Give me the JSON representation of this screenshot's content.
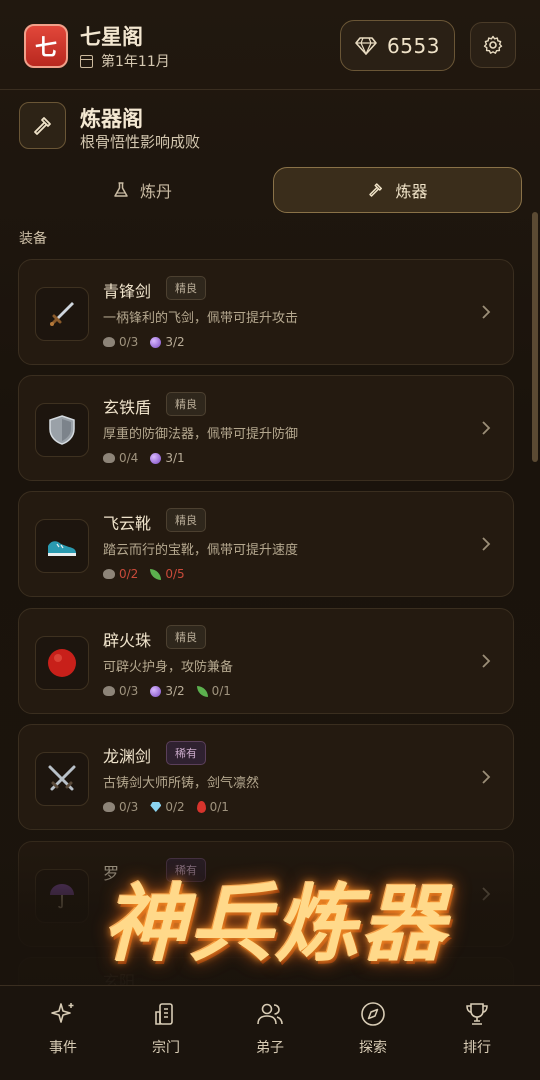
{
  "header": {
    "sect_badge": "七",
    "sect_name": "七星阁",
    "date": "第1年11月",
    "gems": "6553"
  },
  "section": {
    "title": "炼器阁",
    "subtitle": "根骨悟性影响成败"
  },
  "tabs": [
    {
      "label": "炼丹",
      "active": false
    },
    {
      "label": "炼器",
      "active": true
    }
  ],
  "group_label": "装备",
  "items": [
    {
      "name": "青锋剑",
      "tag": "精良",
      "rare": false,
      "desc": "一柄锋利的飞剑，佩带可提升攻击",
      "icon": "sword-icon",
      "mats": [
        {
          "icon": "ore-icon",
          "text": "0/3"
        },
        {
          "icon": "orb-icon",
          "text": "3/2"
        }
      ]
    },
    {
      "name": "玄铁盾",
      "tag": "精良",
      "rare": false,
      "desc": "厚重的防御法器，佩带可提升防御",
      "icon": "shield-icon",
      "mats": [
        {
          "icon": "ore-icon",
          "text": "0/4"
        },
        {
          "icon": "orb-icon",
          "text": "3/1"
        }
      ]
    },
    {
      "name": "飞云靴",
      "tag": "精良",
      "rare": false,
      "desc": "踏云而行的宝靴，佩带可提升速度",
      "icon": "boot-icon",
      "mats": [
        {
          "icon": "ore-icon",
          "text": "0/2"
        },
        {
          "icon": "leaf-icon",
          "text": "0/5"
        }
      ]
    },
    {
      "name": "辟火珠",
      "tag": "精良",
      "rare": false,
      "desc": "可辟火护身，攻防兼备",
      "icon": "red-orb-icon",
      "mats": [
        {
          "icon": "ore-icon",
          "text": "0/3"
        },
        {
          "icon": "orb-icon",
          "text": "3/2"
        },
        {
          "icon": "leaf-icon",
          "text": "0/1"
        }
      ]
    },
    {
      "name": "龙渊剑",
      "tag": "稀有",
      "rare": true,
      "desc": "古铸剑大师所铸，剑气凛然",
      "icon": "crossed-swords-icon",
      "mats": [
        {
          "icon": "ore-icon",
          "text": "0/3"
        },
        {
          "icon": "crystal-icon",
          "text": "0/2"
        },
        {
          "icon": "blood-icon",
          "text": "0/1"
        }
      ]
    },
    {
      "name": "罗",
      "tag": "稀有",
      "rare": true,
      "desc": "",
      "icon": "umbrella-icon",
      "mats": []
    }
  ],
  "partial_item_name": "玄阳",
  "banner": "神兵炼器",
  "nav": [
    {
      "label": "事件",
      "icon": "sparkle-icon"
    },
    {
      "label": "宗门",
      "icon": "building-icon"
    },
    {
      "label": "弟子",
      "icon": "users-icon"
    },
    {
      "label": "探索",
      "icon": "compass-icon"
    },
    {
      "label": "排行",
      "icon": "trophy-icon"
    }
  ],
  "colors": {
    "accent_gold": "#8a7248",
    "badge_red": "#d23a2e",
    "shortage_red": "#c94a3a"
  }
}
